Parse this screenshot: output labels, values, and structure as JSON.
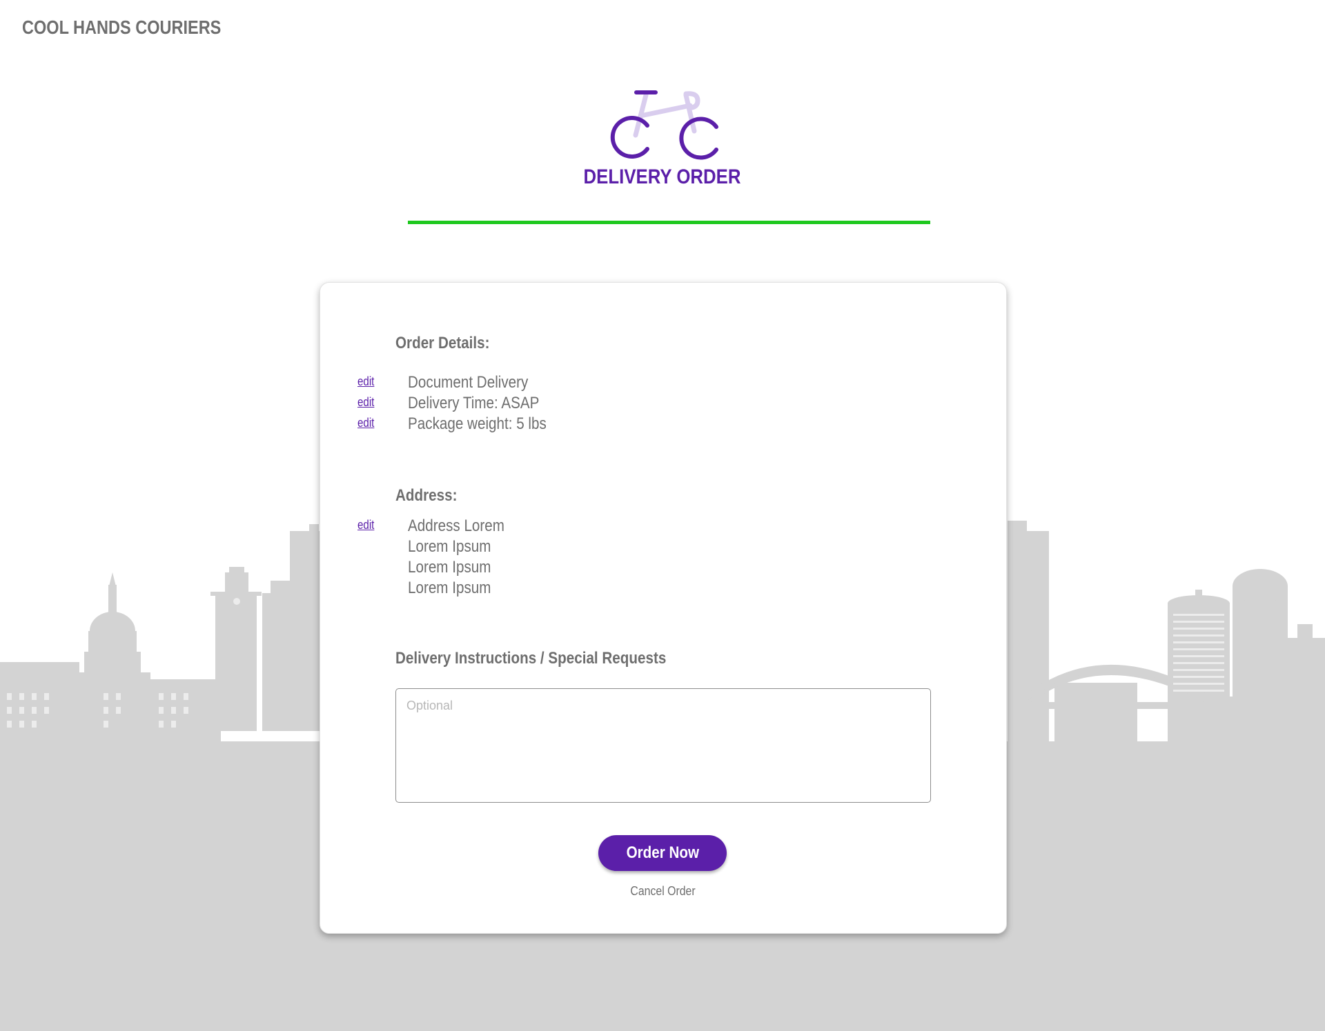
{
  "brand": {
    "name": "COOL HANDS COURIERS"
  },
  "header": {
    "logo_icon": "bicycle-icon",
    "title": "DELIVERY ORDER",
    "progress_fraction": 1.0
  },
  "colors": {
    "accent": "#5b1fa9",
    "progress": "#1ec81e",
    "text": "#6e6e6e",
    "skyline": "#d3d3d3"
  },
  "order_details": {
    "heading": "Order Details:",
    "edit_label": "edit",
    "items": [
      "Document Delivery",
      "Delivery Time: ASAP",
      "Package weight: 5 lbs"
    ]
  },
  "address": {
    "heading": "Address:",
    "edit_label": "edit",
    "lines": [
      "Address Lorem",
      "Lorem Ipsum",
      "Lorem Ipsum",
      "Lorem Ipsum"
    ]
  },
  "instructions": {
    "heading": "Delivery Instructions / Special Requests",
    "placeholder": "Optional",
    "value": ""
  },
  "actions": {
    "order_label": "Order Now",
    "cancel_label": "Cancel Order"
  }
}
